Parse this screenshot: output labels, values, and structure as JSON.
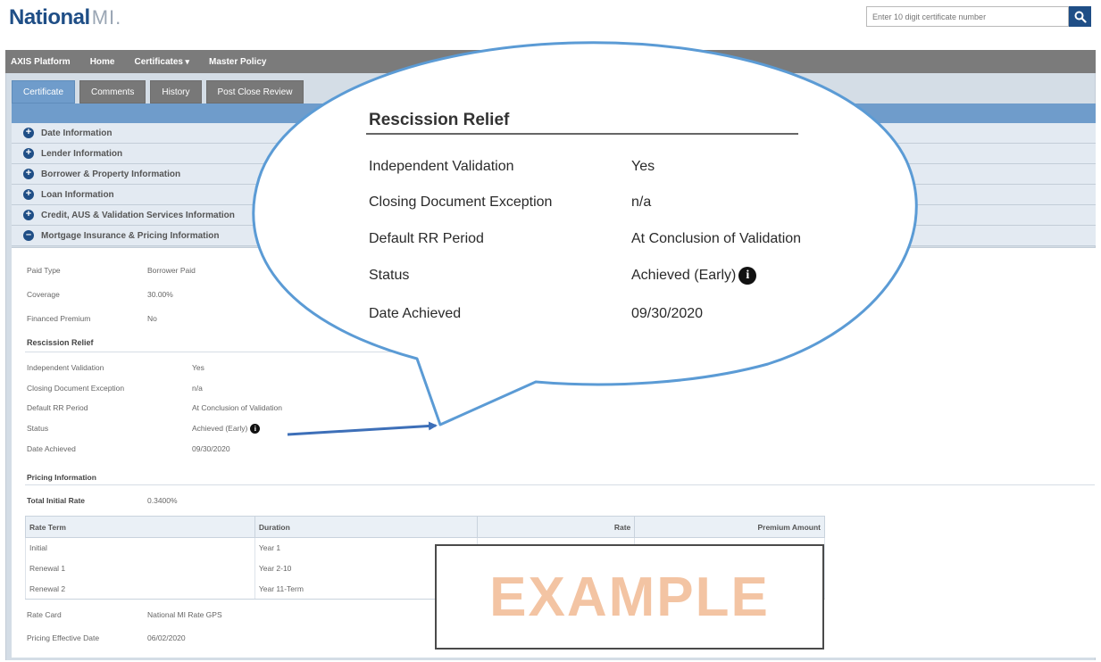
{
  "header": {
    "logo_text_bold": "National",
    "logo_text_light": "MI.",
    "search": {
      "placeholder": "Enter 10 digit certificate number"
    }
  },
  "nav": {
    "items": [
      {
        "label": "AXIS Platform"
      },
      {
        "label": "Home"
      },
      {
        "label": "Certificates"
      },
      {
        "label": "Master Policy"
      }
    ]
  },
  "tabs": [
    {
      "label": "Certificate",
      "active": true
    },
    {
      "label": "Comments"
    },
    {
      "label": "History"
    },
    {
      "label": "Post Close Review"
    }
  ],
  "sections": [
    {
      "label": "Date Information",
      "expanded": false
    },
    {
      "label": "Lender Information",
      "expanded": false
    },
    {
      "label": "Borrower & Property Information",
      "expanded": false
    },
    {
      "label": "Loan Information",
      "expanded": false
    },
    {
      "label": "Credit, AUS & Validation Services Information",
      "expanded": false
    },
    {
      "label": "Mortgage Insurance & Pricing Information",
      "expanded": true
    }
  ],
  "mi_fields": [
    {
      "label": "Paid Type",
      "value": "Borrower Paid"
    },
    {
      "label": "Coverage",
      "value": "30.00%"
    },
    {
      "label": "Financed Premium",
      "value": "No"
    }
  ],
  "rescission": {
    "heading": "Rescission Relief",
    "fields": [
      {
        "label": "Independent Validation",
        "value": "Yes"
      },
      {
        "label": "Closing Document Exception",
        "value": "n/a"
      },
      {
        "label": "Default RR Period",
        "value": "At Conclusion of Validation"
      },
      {
        "label": "Status",
        "value": "Achieved (Early)"
      },
      {
        "label": "Date Achieved",
        "value": "09/30/2020"
      }
    ]
  },
  "pricing": {
    "heading": "Pricing Information",
    "total_label": "Total Initial Rate",
    "total_value": "0.3400%",
    "table": {
      "headers": [
        "Rate Term",
        "Duration",
        "Rate",
        "Premium Amount"
      ],
      "rows": [
        [
          "Initial",
          "Year 1",
          "",
          ""
        ],
        [
          "Renewal 1",
          "Year 2-10",
          "",
          ""
        ],
        [
          "Renewal 2",
          "Year 11-Term",
          "",
          ""
        ]
      ]
    },
    "rate_card_label": "Rate Card",
    "rate_card_value": "National MI Rate GPS",
    "effective_label": "Pricing Effective Date",
    "effective_value": "06/02/2020"
  },
  "example_overlay": "EXAMPLE",
  "colors": {
    "brand_blue": "#1f4e86",
    "nav_gray": "#7b7b7b",
    "tab_active": "#6f9ccb",
    "callout_stroke": "#5b9bd5",
    "example_text": "#f3c4a3"
  },
  "icons": [
    "search-icon",
    "plus-circle-icon",
    "minus-circle-icon",
    "info-icon",
    "caret-down-icon"
  ]
}
